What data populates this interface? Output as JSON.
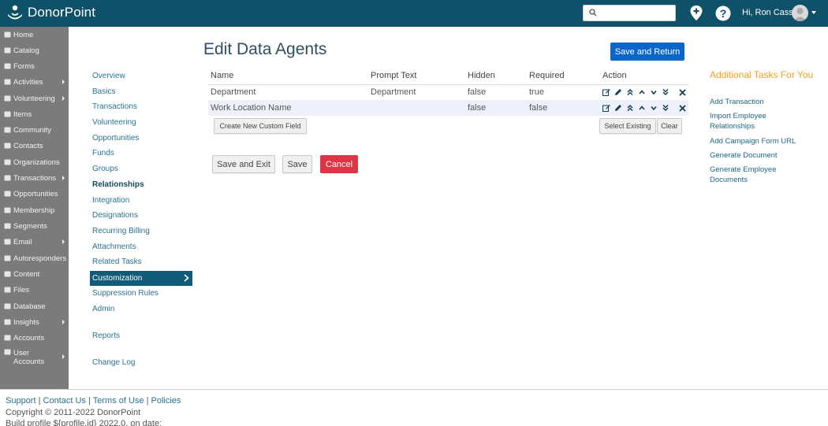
{
  "app": {
    "name": "DonorPoint"
  },
  "header": {
    "search_placeholder": "",
    "greeting": "Hi, Ron Cass"
  },
  "sidebar": {
    "items": [
      {
        "label": "Home",
        "icon": "home-icon",
        "submenu": false
      },
      {
        "label": "Catalog",
        "icon": "cart-icon",
        "submenu": false
      },
      {
        "label": "Forms",
        "icon": "folder-icon",
        "submenu": false
      },
      {
        "label": "Activities",
        "icon": "calendar-icon",
        "submenu": true
      },
      {
        "label": "Volunteering",
        "icon": "hands-icon",
        "submenu": true
      },
      {
        "label": "Items",
        "icon": "tags-icon",
        "submenu": false
      },
      {
        "label": "Community",
        "icon": "users-icon",
        "submenu": false
      },
      {
        "label": "Contacts",
        "icon": "user-icon",
        "submenu": false
      },
      {
        "label": "Organizations",
        "icon": "building-icon",
        "submenu": false
      },
      {
        "label": "Transactions",
        "icon": "money-icon",
        "submenu": true
      },
      {
        "label": "Opportunities",
        "icon": "target-icon",
        "submenu": false
      },
      {
        "label": "Membership",
        "icon": "id-card-icon",
        "submenu": false
      },
      {
        "label": "Segments",
        "icon": "pie-icon",
        "submenu": false
      },
      {
        "label": "Email",
        "icon": "envelope-icon",
        "submenu": true
      },
      {
        "label": "Autoresponders",
        "icon": "book-icon",
        "submenu": false
      },
      {
        "label": "Content",
        "icon": "folder-open-icon",
        "submenu": false
      },
      {
        "label": "Files",
        "icon": "folder-icon",
        "submenu": false
      },
      {
        "label": "Database",
        "icon": "database-icon",
        "submenu": false
      },
      {
        "label": "Insights",
        "icon": "chart-icon",
        "submenu": true
      },
      {
        "label": "Accounts",
        "icon": "bank-icon",
        "submenu": false
      },
      {
        "label": "User Accounts",
        "icon": "user-file-icon",
        "submenu": true
      }
    ]
  },
  "subnav": {
    "items": [
      "Overview",
      "Basics",
      "Transactions",
      "Volunteering",
      "Opportunities",
      "Funds",
      "Groups",
      "Relationships",
      "Integration",
      "Designations",
      "Recurring Billing",
      "Attachments",
      "Related Tasks",
      "Customization",
      "Suppression Rules",
      "Admin"
    ],
    "extra": [
      "Reports",
      "Change Log"
    ],
    "active": "Customization"
  },
  "main": {
    "title": "Edit Data Agents",
    "save_return_label": "Save and Return",
    "table": {
      "columns": [
        "Name",
        "Prompt Text",
        "Hidden",
        "Required",
        "Action"
      ],
      "rows": [
        {
          "name": "Department",
          "prompt": "Department",
          "hidden": "false",
          "required": "true"
        },
        {
          "name": "Work Location Name",
          "prompt": "",
          "hidden": "false",
          "required": "false"
        }
      ]
    },
    "create_custom_label": "Create New Custom Field",
    "select_existing_label": "Select Existing",
    "clear_label": "Clear",
    "save_exit_label": "Save and Exit",
    "save_label": "Save",
    "cancel_label": "Cancel"
  },
  "tasks": {
    "title": "Additional Tasks For You",
    "links": [
      "Add Transaction",
      "Import Employee Relationships",
      "Add Campaign Form URL",
      "Generate Document",
      "Generate Employee Documents"
    ]
  },
  "footer": {
    "links": [
      "Support",
      "Contact Us",
      "Terms of Use",
      "Policies"
    ],
    "copyright": "Copyright © 2011-2022 DonorPoint",
    "build": "Build profile ${profile.id} 2022.0, on date:"
  },
  "colors": {
    "topbar": "#0f5168",
    "sidebar": "#7b7b7b",
    "primary": "#0a67c9",
    "danger": "#dc3545",
    "accent": "#f0a020",
    "active_nav": "#0f5b78"
  }
}
